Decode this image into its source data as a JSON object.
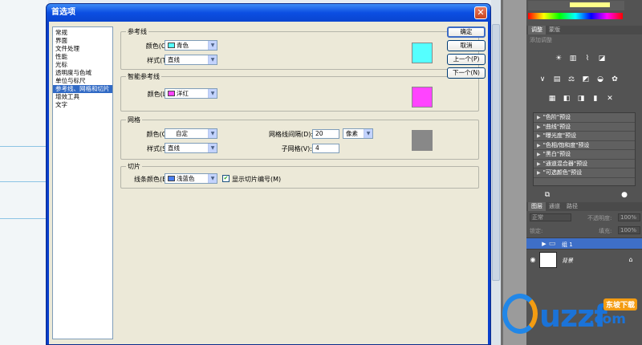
{
  "dialog": {
    "title": "首选项",
    "close_glyph": "✕",
    "nav": [
      "常规",
      "界面",
      "文件处理",
      "性能",
      "光标",
      "透明度与色域",
      "单位与标尺",
      "参考线、网格和切片",
      "增效工具",
      "文字"
    ],
    "selected_nav": 7,
    "buttons": {
      "ok": "确定",
      "cancel": "取消",
      "prev": "上一个(P)",
      "next": "下一个(N)"
    },
    "guides": {
      "title": "参考线",
      "color_label": "颜色(O):",
      "color_value": "青色",
      "color_hex": "#55ffff",
      "style_label": "样式(T):",
      "style_value": "直线"
    },
    "smart_guides": {
      "title": "智能参考线",
      "color_label": "颜色(L):",
      "color_value": "洋红",
      "color_hex": "#ff44ff"
    },
    "grid": {
      "title": "网格",
      "color_label": "颜色(C):",
      "color_value": "自定",
      "color_hex": "#888888",
      "style_label": "样式(S):",
      "style_value": "直线",
      "gridline_label": "网格线间隔(D):",
      "gridline_value": "20",
      "unit_value": "像素",
      "subdiv_label": "子网格(V):",
      "subdiv_value": "4"
    },
    "slices": {
      "title": "切片",
      "line_color_label": "线条颜色(E):",
      "line_color_value": "浅蓝色",
      "line_color_hex": "#4a7ef0",
      "show_numbers_label": "显示切片编号(M)",
      "show_numbers_checked": true
    }
  },
  "ps_panel": {
    "adjust_tabs": [
      "调整",
      "蒙版"
    ],
    "add_adjust_label": "添加调整",
    "presets": [
      "\"色阶\"预设",
      "\"曲线\"预设",
      "\"曝光度\"预设",
      "\"色相/饱和度\"预设",
      "\"黑白\"预设",
      "\"通道混合器\"预设",
      "\"可选颜色\"预设"
    ],
    "layer_tabs": [
      "图层",
      "通道",
      "路径"
    ],
    "blend_mode": "正常",
    "opacity_label": "不透明度:",
    "opacity_value": "100%",
    "lock_label": "锁定:",
    "fill_label": "填充:",
    "fill_value": "100%",
    "layers": [
      {
        "name": "组 1"
      },
      {
        "name": "背景"
      }
    ]
  },
  "watermark": {
    "logo": "uzzf",
    "com": ".com",
    "cn": "东坡下载"
  }
}
